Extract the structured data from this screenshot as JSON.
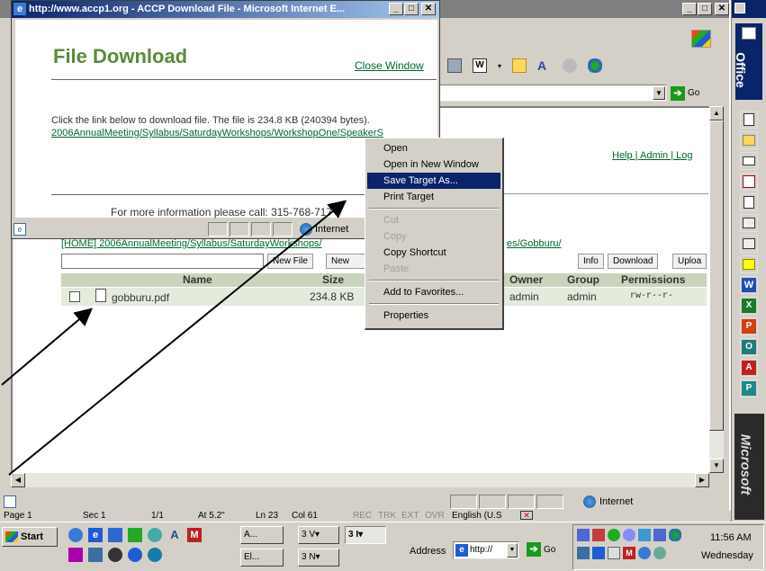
{
  "popup": {
    "title": "http://www.accp1.org - ACCP Download File - Microsoft Internet E...",
    "heading": "File Download",
    "close_link": "Close Window",
    "body_text": "Click the link below to download file. The file is 234.8 KB (240394 bytes).",
    "file_link": "2006AnnualMeeting/Syllabus/SaturdayWorkshops/WorkshopOne/SpeakerS",
    "footer_text": "For more information please call: 315-768-717",
    "status_zone": "Internet"
  },
  "main_window": {
    "go_label": "Go",
    "header_links": "Help | Admin | Log",
    "breadcrumb_left": "[HOME] 2006AnnualMeeting/Syllabus/SaturdayWorkshops/",
    "breadcrumb_right": "es/Gobburu/",
    "buttons": {
      "new_file": "New File",
      "new_folder": "New Fo",
      "info": "Info",
      "download": "Download",
      "upload": "Uploa"
    },
    "table": {
      "columns": [
        "Name",
        "Size",
        "Owner",
        "Group",
        "Permissions"
      ],
      "rows": [
        {
          "name": "gobburu.pdf",
          "size": "234.8 KB",
          "owner": "admin",
          "group": "admin",
          "permissions": "rw-r--r-"
        }
      ]
    },
    "status_zone": "Internet"
  },
  "context_menu": {
    "items": [
      {
        "label": "Open",
        "enabled": true
      },
      {
        "label": "Open in New Window",
        "enabled": true
      },
      {
        "label": "Save Target As...",
        "enabled": true,
        "highlighted": true
      },
      {
        "label": "Print Target",
        "enabled": true
      },
      {
        "separator": true
      },
      {
        "label": "Cut",
        "enabled": false
      },
      {
        "label": "Copy",
        "enabled": false
      },
      {
        "label": "Copy Shortcut",
        "enabled": true
      },
      {
        "label": "Paste",
        "enabled": false
      },
      {
        "separator": true
      },
      {
        "label": "Add to Favorites...",
        "enabled": true
      },
      {
        "separator": true
      },
      {
        "label": "Properties",
        "enabled": true
      }
    ]
  },
  "word_status": {
    "page": "Page 1",
    "sec": "Sec 1",
    "pages": "1/1",
    "at": "At 5.2\"",
    "ln": "Ln 23",
    "col": "Col 61",
    "rec": "REC",
    "trk": "TRK",
    "ext": "EXT",
    "ovr": "OVR",
    "language": "English (U.S"
  },
  "office_bar": {
    "label": "Office",
    "brand": "Microsoft"
  },
  "taskbar": {
    "start": "Start",
    "tasks": [
      {
        "label": "A..."
      },
      {
        "label": "3 V▾"
      },
      {
        "label": "3 I▾"
      },
      {
        "label": "El..."
      },
      {
        "label": "3 N▾"
      }
    ],
    "address_label": "Address",
    "address_value": "http://",
    "go_label": "Go",
    "time": "11:56 AM",
    "day": "Wednesday"
  },
  "colors": {
    "heading_green": "#5a8a3c",
    "link_green": "#006633",
    "menu_highlight": "#0a246a",
    "titlebar_active": "#0a246a"
  }
}
